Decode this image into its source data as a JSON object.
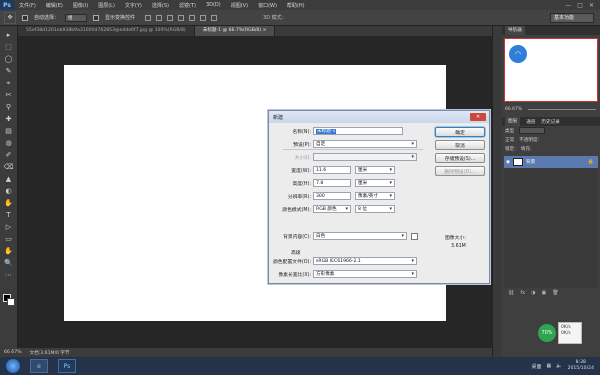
{
  "app": {
    "logo": "Ps",
    "menus": [
      "文件(F)",
      "编辑(E)",
      "图像(I)",
      "图层(L)",
      "文字(Y)",
      "选择(S)",
      "滤镜(T)",
      "3D(D)",
      "视图(V)",
      "窗口(W)",
      "帮助(H)"
    ],
    "window_controls": [
      "—",
      "□",
      "✕"
    ]
  },
  "options": {
    "auto_select_label": "自动选择：",
    "auto_select_value": "组",
    "show_transform_label": "显示变换控件",
    "mode_3d_label": "3D 模式：",
    "workspace": "基本功能"
  },
  "tabs": [
    {
      "label": "55ef38d1201eb938b9a31000d762853@e4de6f7.jpg @ 100%(RGB/8)",
      "active": false
    },
    {
      "label": "未标题-1 @ 66.7%(RGB/8) ×",
      "active": true
    }
  ],
  "tools": [
    "▸",
    "⬚",
    "◯",
    "✎",
    "⌖",
    "✂",
    "⚲",
    "✚",
    "▤",
    "◍",
    "✐",
    "⌫",
    "▲",
    "◐",
    "✋",
    "T",
    "▷",
    "▭",
    "✋",
    "🔍",
    "⋯"
  ],
  "status": {
    "zoom": "66.67%",
    "doc_info": "文档:3.61M/0 字节"
  },
  "panels": {
    "navigator_tab": "导航器",
    "navigator_zoom": "66.67%",
    "layers_tabs": [
      "图层",
      "通道",
      "历史记录"
    ],
    "kind_label": "类型",
    "blend_mode": "正常",
    "opacity_label": "不透明度:",
    "lock_label": "锁定:",
    "fill_label": "填充:",
    "layer_name": "背景"
  },
  "dialog": {
    "title": "新建",
    "name_label": "名称(N):",
    "name_value": "未标题-1",
    "preset_label": "预设(P):",
    "preset_value": "自定",
    "size_label": "大小(I):",
    "width_label": "宽度(W):",
    "width_value": "11.6",
    "width_unit": "厘米",
    "height_label": "高度(H):",
    "height_value": "7.8",
    "height_unit": "厘米",
    "resolution_label": "分辨率(R):",
    "resolution_value": "300",
    "resolution_unit": "像素/英寸",
    "colormode_label": "颜色模式(M):",
    "colormode_value": "RGB 颜色",
    "bitdepth_value": "8 位",
    "bg_label": "背景内容(C):",
    "bg_value": "白色",
    "advanced_label": "高级",
    "profile_label": "颜色配置文件(O):",
    "profile_value": "sRGB IEC61966-2.1",
    "pixel_aspect_label": "像素长宽比(X):",
    "pixel_aspect_value": "方形像素",
    "ok": "确定",
    "cancel": "取消",
    "save_preset": "存储预设(S)...",
    "delete_preset": "删除预设(D)...",
    "image_size_label": "图像大小:",
    "image_size_value": "3.61M"
  },
  "ime": {
    "badge": "70%",
    "line1": "0K/s",
    "line2": "0K/s"
  },
  "taskbar": {
    "tray_label": "桌面",
    "time": "8:38",
    "date": "2015/10/24",
    "apps": [
      "e",
      "Ps"
    ]
  }
}
